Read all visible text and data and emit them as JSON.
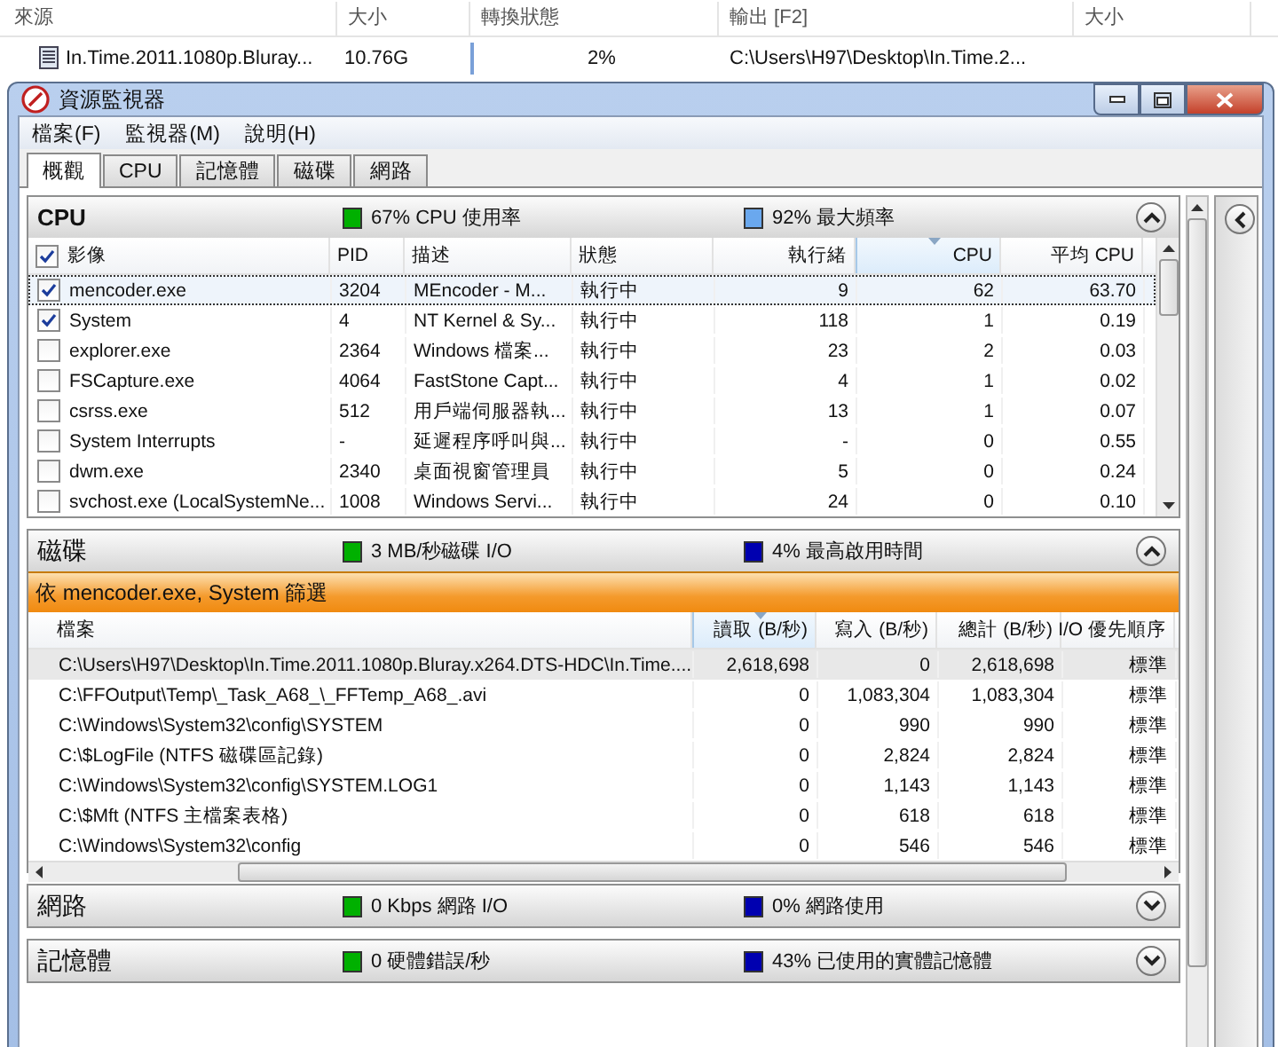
{
  "background_list": {
    "columns": [
      "來源",
      "大小",
      "轉換狀態",
      "輸出 [F2]",
      "大小"
    ],
    "row": {
      "source": "In.Time.2011.1080p.Bluray...",
      "size": "10.76G",
      "status": "2%",
      "output": "C:\\Users\\H97\\Desktop\\In.Time.2..."
    }
  },
  "window": {
    "title": "資源監視器",
    "menu": [
      "檔案(F)",
      "監視器(M)",
      "說明(H)"
    ],
    "tabs": [
      {
        "label": "概觀",
        "selected": true
      },
      {
        "label": "CPU",
        "selected": false
      },
      {
        "label": "記憶體",
        "selected": false
      },
      {
        "label": "磁碟",
        "selected": false
      },
      {
        "label": "網路",
        "selected": false
      }
    ]
  },
  "sections": [
    {
      "kind": "process",
      "title": "CPU",
      "bold": true,
      "expanded": true,
      "metrics": [
        {
          "text": "67% CPU 使用率",
          "color": "#00b000"
        },
        {
          "text": "92% 最大頻率",
          "color": "#6aa8ee"
        }
      ],
      "header_checked": true,
      "columns": [
        {
          "label": "影像",
          "numeric": false,
          "sorted": false
        },
        {
          "label": "PID",
          "numeric": false,
          "sorted": false
        },
        {
          "label": "描述",
          "numeric": false,
          "sorted": false
        },
        {
          "label": "狀態",
          "numeric": false,
          "sorted": false
        },
        {
          "label": "執行緒",
          "numeric": true,
          "sorted": false
        },
        {
          "label": "CPU",
          "numeric": true,
          "sorted": true
        },
        {
          "label": "平均 CPU",
          "numeric": true,
          "sorted": false
        }
      ],
      "rows": [
        {
          "checked": true,
          "selected": true,
          "cells": [
            "mencoder.exe",
            "3204",
            "MEncoder - M...",
            "執行中",
            "9",
            "62",
            "63.70"
          ]
        },
        {
          "checked": true,
          "selected": false,
          "cells": [
            "System",
            "4",
            "NT Kernel & Sy...",
            "執行中",
            "118",
            "1",
            "0.19"
          ]
        },
        {
          "checked": false,
          "selected": false,
          "cells": [
            "explorer.exe",
            "2364",
            "Windows 檔案...",
            "執行中",
            "23",
            "2",
            "0.03"
          ]
        },
        {
          "checked": false,
          "selected": false,
          "cells": [
            "FSCapture.exe",
            "4064",
            "FastStone Capt...",
            "執行中",
            "4",
            "1",
            "0.02"
          ]
        },
        {
          "checked": false,
          "selected": false,
          "cells": [
            "csrss.exe",
            "512",
            "用戶端伺服器執...",
            "執行中",
            "13",
            "1",
            "0.07"
          ]
        },
        {
          "checked": false,
          "selected": false,
          "cells": [
            "System Interrupts",
            "-",
            "延遲程序呼叫與...",
            "執行中",
            "-",
            "0",
            "0.55"
          ]
        },
        {
          "checked": false,
          "selected": false,
          "cells": [
            "dwm.exe",
            "2340",
            "桌面視窗管理員",
            "執行中",
            "5",
            "0",
            "0.24"
          ]
        },
        {
          "checked": false,
          "selected": false,
          "cells": [
            "svchost.exe (LocalSystemNe...",
            "1008",
            "Windows Servi...",
            "執行中",
            "24",
            "0",
            "0.10"
          ]
        }
      ]
    },
    {
      "kind": "file",
      "title": "磁碟",
      "bold": false,
      "expanded": true,
      "metrics": [
        {
          "text": "3 MB/秒磁碟 I/O",
          "color": "#00b000"
        },
        {
          "text": "4% 最高啟用時間",
          "color": "#0000b0"
        }
      ],
      "filter": "依 mencoder.exe, System 篩選",
      "columns": [
        {
          "label": "檔案",
          "numeric": false,
          "sorted": false
        },
        {
          "label": "讀取 (B/秒)",
          "numeric": true,
          "sorted": true
        },
        {
          "label": "寫入 (B/秒)",
          "numeric": true,
          "sorted": false
        },
        {
          "label": "總計 (B/秒)",
          "numeric": true,
          "sorted": false
        },
        {
          "label": "I/O 優先順序",
          "numeric": true,
          "sorted": false
        }
      ],
      "rows": [
        {
          "selected": true,
          "cells": [
            "C:\\Users\\H97\\Desktop\\In.Time.2011.1080p.Bluray.x264.DTS-HDC\\In.Time....",
            "2,618,698",
            "0",
            "2,618,698",
            "標準"
          ]
        },
        {
          "selected": false,
          "cells": [
            "C:\\FFOutput\\Temp\\_Task_A68_\\_FFTemp_A68_.avi",
            "0",
            "1,083,304",
            "1,083,304",
            "標準"
          ]
        },
        {
          "selected": false,
          "cells": [
            "C:\\Windows\\System32\\config\\SYSTEM",
            "0",
            "990",
            "990",
            "標準"
          ]
        },
        {
          "selected": false,
          "cells": [
            "C:\\$LogFile (NTFS 磁碟區記錄)",
            "0",
            "2,824",
            "2,824",
            "標準"
          ]
        },
        {
          "selected": false,
          "cells": [
            "C:\\Windows\\System32\\config\\SYSTEM.LOG1",
            "0",
            "1,143",
            "1,143",
            "標準"
          ]
        },
        {
          "selected": false,
          "cells": [
            "C:\\$Mft (NTFS 主檔案表格)",
            "0",
            "618",
            "618",
            "標準"
          ]
        },
        {
          "selected": false,
          "cells": [
            "C:\\Windows\\System32\\config",
            "0",
            "546",
            "546",
            "標準"
          ]
        }
      ]
    },
    {
      "kind": "summary",
      "title": "網路",
      "bold": false,
      "expanded": false,
      "metrics": [
        {
          "text": "0 Kbps 網路 I/O",
          "color": "#00b000"
        },
        {
          "text": "0% 網路使用",
          "color": "#0000b0"
        }
      ]
    },
    {
      "kind": "summary",
      "title": "記憶體",
      "bold": false,
      "expanded": false,
      "metrics": [
        {
          "text": "0 硬體錯誤/秒",
          "color": "#00b000"
        },
        {
          "text": "43% 已使用的實體記憶體",
          "color": "#0000b0"
        }
      ]
    }
  ]
}
